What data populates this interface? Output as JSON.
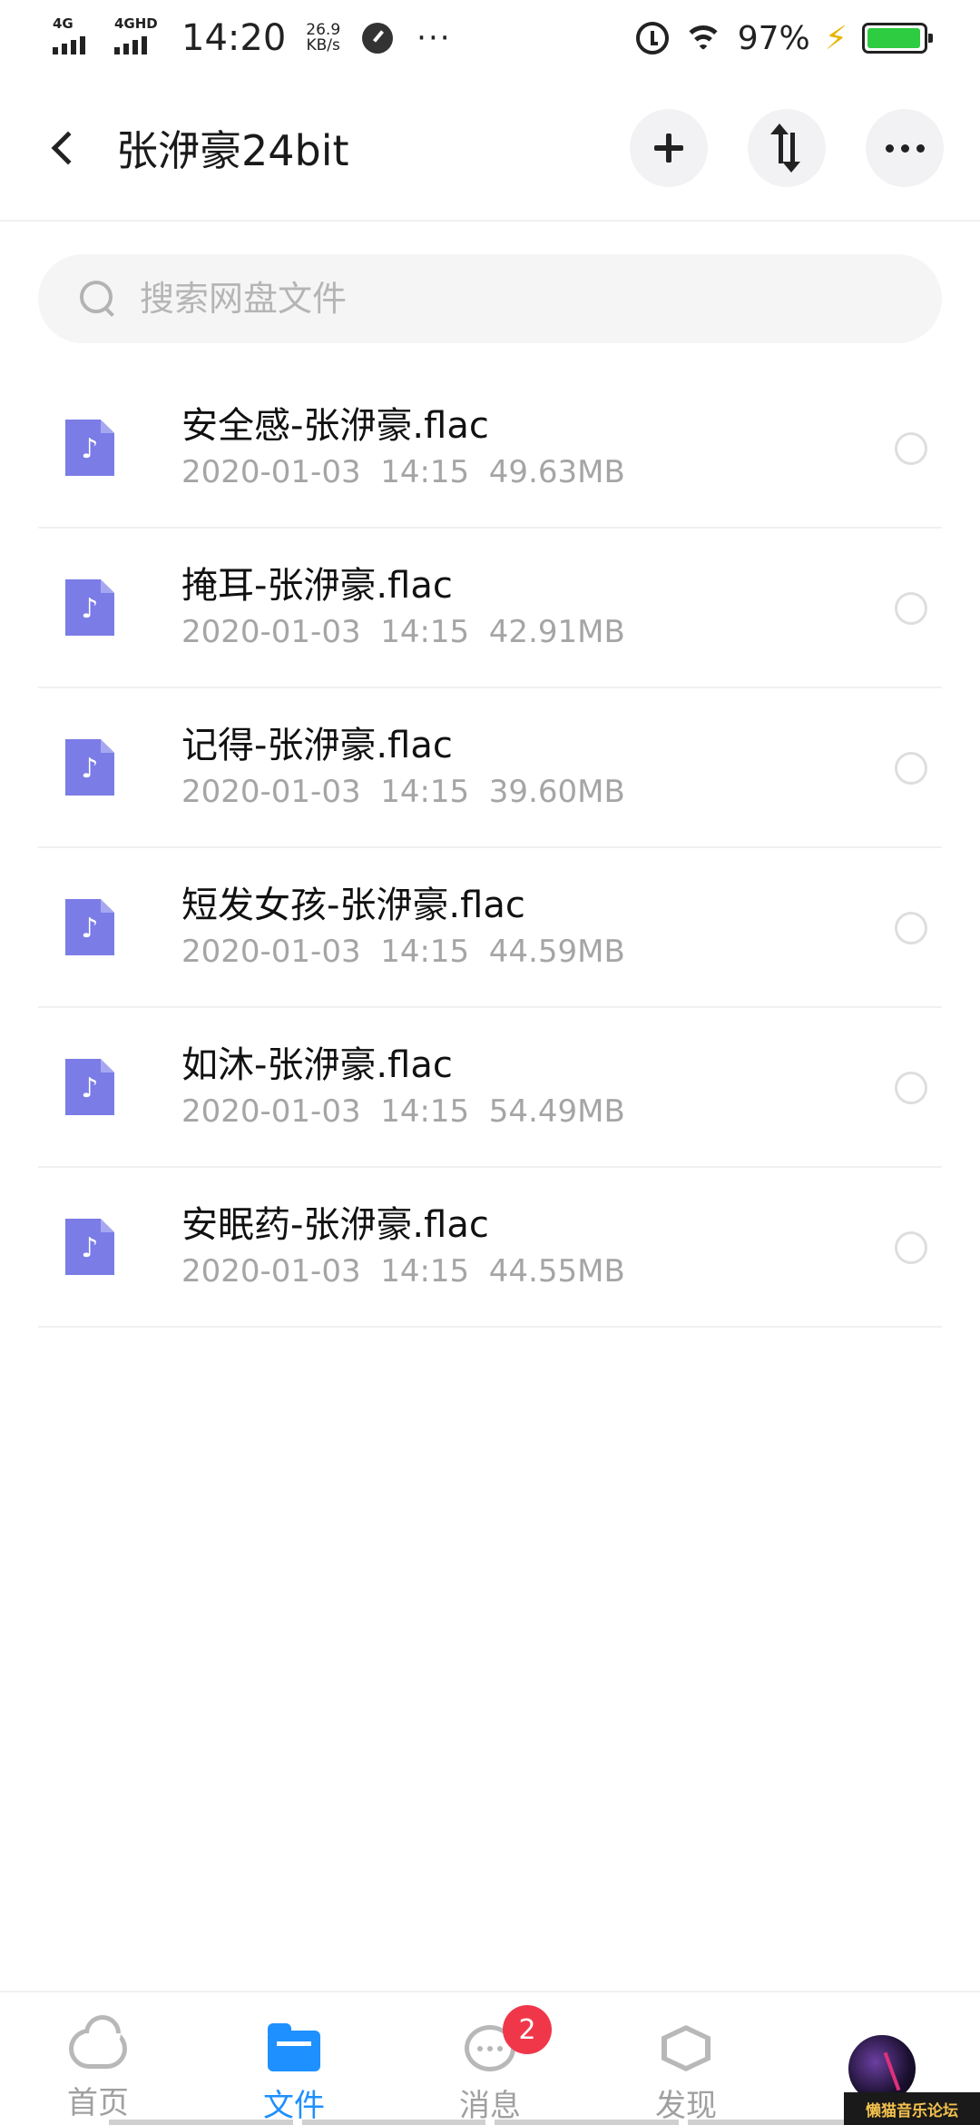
{
  "status_bar": {
    "network1": "4G",
    "network2": "4GHD",
    "time": "14:20",
    "speed_value": "26.9",
    "speed_unit": "KB/s",
    "more": "···",
    "battery_pct": "97%"
  },
  "header": {
    "title": "张洢豪24bit",
    "icons": [
      "back-icon",
      "plus-icon",
      "sort-icon",
      "more-icon"
    ]
  },
  "search": {
    "placeholder": "搜索网盘文件"
  },
  "files": [
    {
      "name": "安全感-张洢豪.flac",
      "meta": "2020-01-03  14:15  49.63MB"
    },
    {
      "name": "掩耳-张洢豪.flac",
      "meta": "2020-01-03  14:15  42.91MB"
    },
    {
      "name": "记得-张洢豪.flac",
      "meta": "2020-01-03  14:15  39.60MB"
    },
    {
      "name": "短发女孩-张洢豪.flac",
      "meta": "2020-01-03  14:15  44.59MB"
    },
    {
      "name": "如沐-张洢豪.flac",
      "meta": "2020-01-03  14:15  54.49MB"
    },
    {
      "name": "安眠药-张洢豪.flac",
      "meta": "2020-01-03  14:15  44.55MB"
    }
  ],
  "bottom_nav": {
    "home": "首页",
    "files": "文件",
    "messages": "消息",
    "messages_badge": "2",
    "discover": "发现",
    "active": "files"
  },
  "watermark": "懒猫音乐论坛",
  "colors": {
    "accent": "#1e90ff",
    "file_icon": "#7b7ce6",
    "badge": "#f0374a",
    "battery": "#2ecc40"
  }
}
